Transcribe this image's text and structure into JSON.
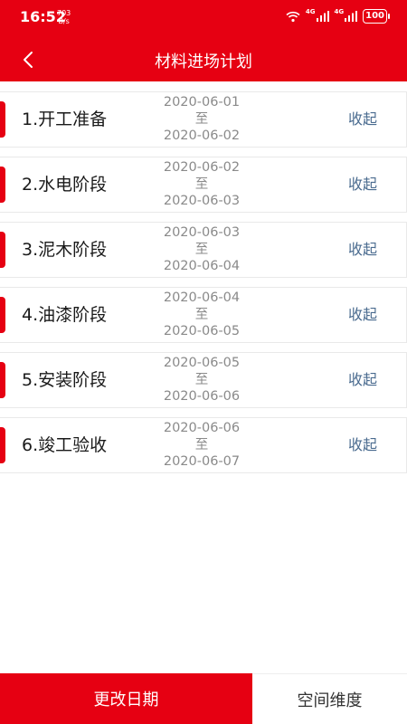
{
  "status_bar": {
    "time": "16:52",
    "net_speed_value": "703",
    "net_speed_unit": "B/s",
    "network_1": "4G",
    "network_2": "4G",
    "battery": "100"
  },
  "header": {
    "title": "材料进场计划",
    "back_icon": "chevron-left-icon"
  },
  "rows": [
    {
      "label": "1.开工准备",
      "start": "2020-06-01",
      "sep": "至",
      "end": "2020-06-02",
      "action": "收起"
    },
    {
      "label": "2.水电阶段",
      "start": "2020-06-02",
      "sep": "至",
      "end": "2020-06-03",
      "action": "收起"
    },
    {
      "label": "3.泥木阶段",
      "start": "2020-06-03",
      "sep": "至",
      "end": "2020-06-04",
      "action": "收起"
    },
    {
      "label": "4.油漆阶段",
      "start": "2020-06-04",
      "sep": "至",
      "end": "2020-06-05",
      "action": "收起"
    },
    {
      "label": "5.安装阶段",
      "start": "2020-06-05",
      "sep": "至",
      "end": "2020-06-06",
      "action": "收起"
    },
    {
      "label": "6.竣工验收",
      "start": "2020-06-06",
      "sep": "至",
      "end": "2020-06-07",
      "action": "收起"
    }
  ],
  "bottom_bar": {
    "primary_label": "更改日期",
    "secondary_label": "空间维度"
  },
  "colors": {
    "brand": "#e60012",
    "link": "#4a6b8f"
  }
}
